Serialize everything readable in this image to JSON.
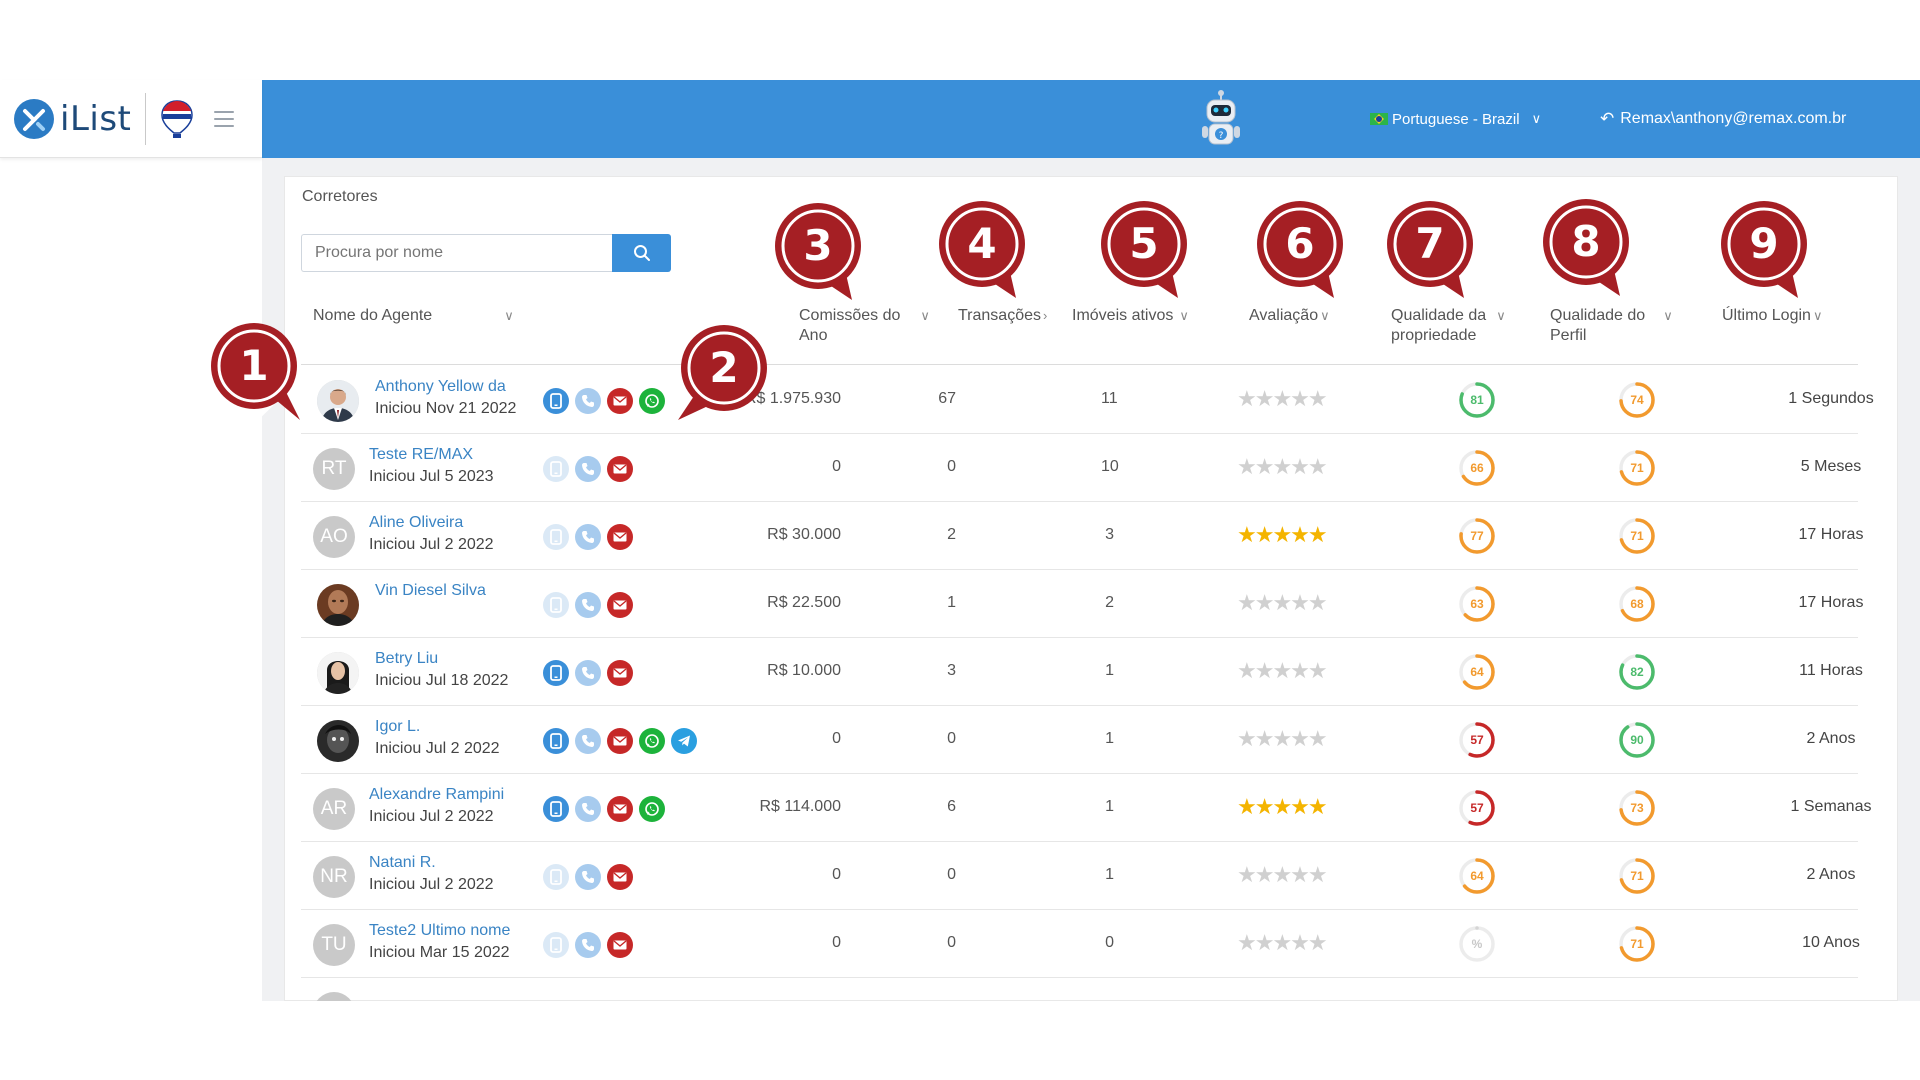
{
  "topbar": {
    "brand": "iList",
    "language": "Portuguese - Brazil",
    "account": "Remax\\anthony@remax.com.br"
  },
  "panel": {
    "title": "Corretores",
    "search_placeholder": "Procura por nome"
  },
  "columns": {
    "agent": "Nome do Agente",
    "commissions": [
      "Comissões do",
      "Ano"
    ],
    "transactions": "Transações",
    "active": "Imóveis ativos",
    "rating": "Avaliação",
    "prop_quality": [
      "Qualidade da",
      "propriedade"
    ],
    "profile_quality": [
      "Qualidade do",
      "Perfil"
    ],
    "last_login": "Último Login"
  },
  "colors": {
    "brand_blue": "#3a8fd9",
    "marker_red": "#a51f24",
    "gauge_green": "#4cbb6c",
    "gauge_orange": "#f29a2e",
    "gauge_red": "#c62828"
  },
  "rows": [
    {
      "name": "Anthony Yellow da",
      "since": "Iniciou Nov 21 2022",
      "initials": "",
      "photo": "man-suit",
      "icons": [
        "mobile",
        "phone",
        "mail",
        "whatsapp"
      ],
      "mobile_on": true,
      "commission": "R$ 1.975.930",
      "transactions": "67",
      "active": "11",
      "rating": 0,
      "prop_quality": 81,
      "profile_quality": 74,
      "last_login": "1 Segundos"
    },
    {
      "name": "Teste RE/MAX",
      "since": "Iniciou Jul 5 2023",
      "initials": "RT",
      "photo": "",
      "icons": [
        "mobile",
        "phone",
        "mail"
      ],
      "mobile_on": false,
      "commission": "0",
      "transactions": "0",
      "active": "10",
      "rating": 0,
      "prop_quality": 66,
      "profile_quality": 71,
      "last_login": "5 Meses"
    },
    {
      "name": "Aline Oliveira",
      "since": "Iniciou Jul 2 2022",
      "initials": "AO",
      "photo": "",
      "icons": [
        "mobile",
        "phone",
        "mail"
      ],
      "mobile_on": false,
      "commission": "R$ 30.000",
      "transactions": "2",
      "active": "3",
      "rating": 5,
      "prop_quality": 77,
      "profile_quality": 71,
      "last_login": "17 Horas"
    },
    {
      "name": "Vin Diesel Silva",
      "since": "",
      "initials": "",
      "photo": "man-bald",
      "icons": [
        "mobile",
        "phone",
        "mail"
      ],
      "mobile_on": false,
      "commission": "R$ 22.500",
      "transactions": "1",
      "active": "2",
      "rating": 0,
      "prop_quality": 63,
      "profile_quality": 68,
      "last_login": "17 Horas"
    },
    {
      "name": "Betry Liu",
      "since": "Iniciou Jul 18 2022",
      "initials": "",
      "photo": "woman",
      "icons": [
        "mobile",
        "phone",
        "mail"
      ],
      "mobile_on": true,
      "commission": "R$ 10.000",
      "transactions": "3",
      "active": "1",
      "rating": 0,
      "prop_quality": 64,
      "profile_quality": 82,
      "last_login": "11 Horas"
    },
    {
      "name": "Igor L.",
      "since": "Iniciou Jul 2 2022",
      "initials": "",
      "photo": "dark",
      "icons": [
        "mobile",
        "phone",
        "mail",
        "whatsapp",
        "telegram"
      ],
      "mobile_on": true,
      "commission": "0",
      "transactions": "0",
      "active": "1",
      "rating": 0,
      "prop_quality": 57,
      "profile_quality": 90,
      "last_login": "2 Anos"
    },
    {
      "name": "Alexandre Rampini",
      "since": "Iniciou Jul 2 2022",
      "initials": "AR",
      "photo": "",
      "icons": [
        "mobile",
        "phone",
        "mail",
        "whatsapp"
      ],
      "mobile_on": true,
      "commission": "R$ 114.000",
      "transactions": "6",
      "active": "1",
      "rating": 5,
      "prop_quality": 57,
      "profile_quality": 73,
      "last_login": "1 Semanas"
    },
    {
      "name": "Natani R.",
      "since": "Iniciou Jul 2 2022",
      "initials": "NR",
      "photo": "",
      "icons": [
        "mobile",
        "phone",
        "mail"
      ],
      "mobile_on": false,
      "commission": "0",
      "transactions": "0",
      "active": "1",
      "rating": 0,
      "prop_quality": 64,
      "profile_quality": 71,
      "last_login": "2 Anos"
    },
    {
      "name": "Teste2 Ultimo nome",
      "since": "Iniciou Mar 15 2022",
      "initials": "TU",
      "photo": "",
      "icons": [
        "mobile",
        "phone",
        "mail"
      ],
      "mobile_on": false,
      "commission": "0",
      "transactions": "0",
      "active": "0",
      "rating": 0,
      "prop_quality": null,
      "prop_quality_label": "%",
      "profile_quality": 71,
      "last_login": "10 Anos"
    }
  ],
  "markers": [
    "1",
    "2",
    "3",
    "4",
    "5",
    "6",
    "7",
    "8",
    "9"
  ]
}
